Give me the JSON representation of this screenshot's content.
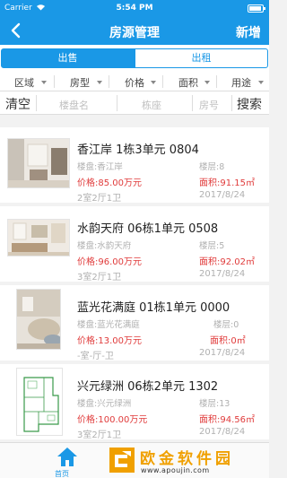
{
  "status_bar": {
    "carrier": "Carrier",
    "time": "5:54 PM"
  },
  "nav": {
    "title": "房源管理",
    "add_label": "新增"
  },
  "segment": {
    "sale_label": "出售",
    "rent_label": "出租"
  },
  "filters": [
    "区域",
    "房型",
    "价格",
    "面积",
    "用途"
  ],
  "search": {
    "clear_label": "清空",
    "estate_placeholder": "楼盘名",
    "building_placeholder": "栋座",
    "room_placeholder": "房号",
    "search_label": "搜索"
  },
  "listings": [
    {
      "title": "香江岸 1栋3单元 0804",
      "estate": "楼盘:香江岸",
      "floor": "楼层:8",
      "price": "价格:85.00万元",
      "area": "面积:91.15㎡",
      "layout": "2室2厅1卫",
      "date": "2017/8/24"
    },
    {
      "title": "水韵天府 06栋1单元 0508",
      "estate": "楼盘:水韵天府",
      "floor": "楼层:5",
      "price": "价格:96.00万元",
      "area": "面积:92.02㎡",
      "layout": "3室2厅1卫",
      "date": "2017/8/24"
    },
    {
      "title": "蓝光花满庭 01栋1单元 0000",
      "estate": "楼盘:蓝光花满庭",
      "floor": "楼层:0",
      "price": "价格:13.00万元",
      "area": "面积:0㎡",
      "layout": "-室-厅-卫",
      "date": "2017/8/24"
    },
    {
      "title": "兴元绿洲 06栋2单元 1302",
      "estate": "楼盘:兴元绿洲",
      "floor": "楼层:13",
      "price": "价格:100.00万元",
      "area": "面积:94.56㎡",
      "layout": "3室2厅1卫",
      "date": "2017/8/24"
    }
  ],
  "tabbar": {
    "home_label": "首页"
  },
  "watermark": {
    "title": "欧金软件园",
    "url": "www.apoujin.com"
  },
  "colors": {
    "primary": "#1a98e6",
    "price_red": "#e03b3b",
    "muted": "#b0b0b0",
    "watermark": "#f0a000"
  }
}
